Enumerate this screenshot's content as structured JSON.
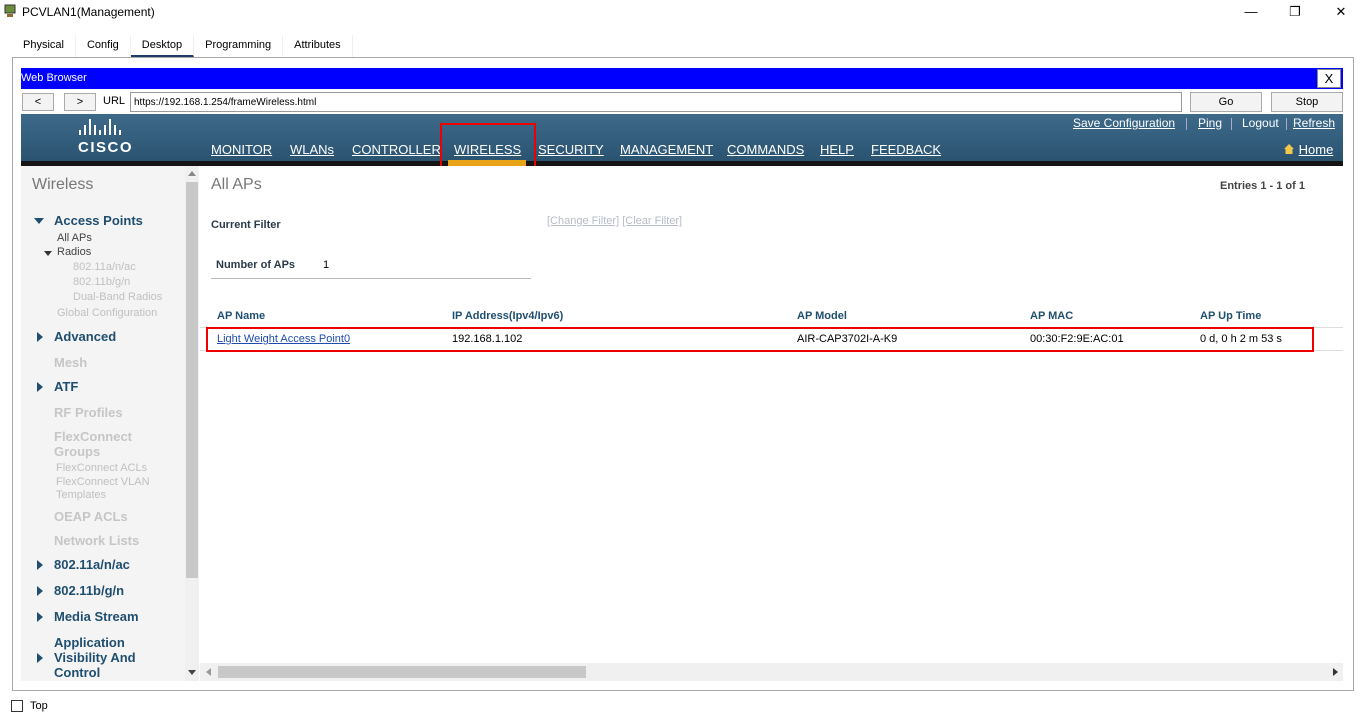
{
  "window": {
    "title": "PCVLAN1(Management)",
    "minimize": "—",
    "restore": "❐",
    "close": "✕"
  },
  "tabs": [
    "Physical",
    "Config",
    "Desktop",
    "Programming",
    "Attributes"
  ],
  "active_tab": "Desktop",
  "browser": {
    "title": "Web Browser",
    "close": "X",
    "back": "<",
    "forward": ">",
    "url_label": "URL",
    "url": "https://192.168.1.254/frameWireless.html",
    "go": "Go",
    "stop": "Stop"
  },
  "header": {
    "logo_text": "CISCO",
    "links": [
      "Save Configuration",
      "Ping",
      "Logout",
      "Refresh"
    ],
    "menu": [
      "MONITOR",
      "WLANs",
      "CONTROLLER",
      "WIRELESS",
      "SECURITY",
      "MANAGEMENT",
      "COMMANDS",
      "HELP",
      "FEEDBACK"
    ],
    "active_menu": "WIRELESS",
    "home": "Home",
    "accent_color": "#e8a317"
  },
  "sidebar": {
    "title": "Wireless",
    "access_points": "Access Points",
    "all_aps": "All APs",
    "radios": "Radios",
    "radio_items": [
      "802.11a/n/ac",
      "802.11b/g/n",
      "Dual-Band Radios"
    ],
    "global_config": "Global Configuration",
    "advanced": "Advanced",
    "mesh": "Mesh",
    "atf": "ATF",
    "rf_profiles": "RF Profiles",
    "flexconnect_groups_1": "FlexConnect",
    "flexconnect_groups_2": "Groups",
    "flexconnect_acls": "FlexConnect ACLs",
    "flexconnect_vlan_1": "FlexConnect VLAN",
    "flexconnect_vlan_2": "Templates",
    "oeap_acls": "OEAP ACLs",
    "network_lists": "Network Lists",
    "dot11a": "802.11a/n/ac",
    "dot11b": "802.11b/g/n",
    "media_stream": "Media Stream",
    "app_vis_1": "Application",
    "app_vis_2": "Visibility And",
    "app_vis_3": "Control"
  },
  "content": {
    "title": "All APs",
    "entries": "Entries 1 - 1 of 1",
    "current_filter": "Current Filter",
    "change_filter": "[Change Filter]",
    "clear_filter": "[Clear Filter]",
    "number_of_aps_label": "Number of APs",
    "number_of_aps": "1",
    "columns": [
      "AP Name",
      "IP Address(Ipv4/Ipv6)",
      "AP Model",
      "AP MAC",
      "AP Up Time"
    ],
    "rows": [
      [
        "Light Weight Access Point0",
        "192.168.1.102",
        "AIR-CAP3702I-A-K9",
        "00:30:F2:9E:AC:01",
        "0 d, 0 h 2 m 53 s"
      ]
    ]
  },
  "footer": {
    "top_label": "Top"
  }
}
